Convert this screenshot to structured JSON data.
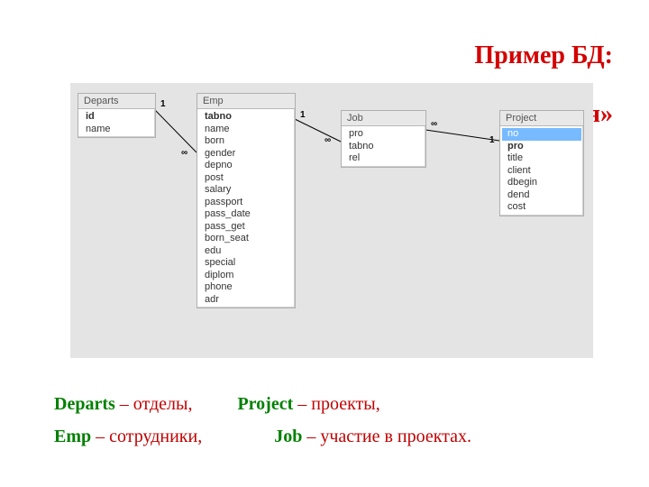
{
  "title": {
    "line1": "Пример БД:",
    "line2": "«Проектная организация»",
    "color": "#d40000"
  },
  "tables": {
    "departs": {
      "name": "Departs",
      "fields": [
        {
          "name": "id",
          "bold": true
        },
        {
          "name": "name",
          "bold": false
        }
      ]
    },
    "emp": {
      "name": "Emp",
      "fields": [
        {
          "name": "tabno",
          "bold": true
        },
        {
          "name": "name",
          "bold": false
        },
        {
          "name": "born",
          "bold": false
        },
        {
          "name": "gender",
          "bold": false
        },
        {
          "name": "depno",
          "bold": false
        },
        {
          "name": "post",
          "bold": false
        },
        {
          "name": "salary",
          "bold": false
        },
        {
          "name": "passport",
          "bold": false
        },
        {
          "name": "pass_date",
          "bold": false
        },
        {
          "name": "pass_get",
          "bold": false
        },
        {
          "name": "born_seat",
          "bold": false
        },
        {
          "name": "edu",
          "bold": false
        },
        {
          "name": "special",
          "bold": false
        },
        {
          "name": "diplom",
          "bold": false
        },
        {
          "name": "phone",
          "bold": false
        },
        {
          "name": "adr",
          "bold": false
        }
      ]
    },
    "job": {
      "name": "Job",
      "fields": [
        {
          "name": "pro",
          "bold": false
        },
        {
          "name": "tabno",
          "bold": false
        },
        {
          "name": "rel",
          "bold": false
        }
      ]
    },
    "project": {
      "name": "Project",
      "fields": [
        {
          "name": "no",
          "bold": false,
          "sel": true
        },
        {
          "name": "pro",
          "bold": true
        },
        {
          "name": "title",
          "bold": false
        },
        {
          "name": "client",
          "bold": false
        },
        {
          "name": "dbegin",
          "bold": false
        },
        {
          "name": "dend",
          "bold": false
        },
        {
          "name": "cost",
          "bold": false
        }
      ]
    }
  },
  "relations": {
    "departs_emp": {
      "one": "1",
      "many": "∞"
    },
    "emp_job": {
      "one": "1",
      "many": "∞"
    },
    "project_job": {
      "one": "1",
      "many": "∞"
    }
  },
  "legend": {
    "departs": {
      "label": "Departs",
      "desc": "– отделы,",
      "color": "#008000"
    },
    "project": {
      "label": "Project",
      "desc": "– проекты,",
      "color": "#008000"
    },
    "emp": {
      "label": "Emp",
      "desc": "– сотрудники,",
      "color": "#008000"
    },
    "job": {
      "label": "Job",
      "desc": "– участие в проектах.",
      "color": "#008000"
    },
    "descColor": "#c00000"
  }
}
